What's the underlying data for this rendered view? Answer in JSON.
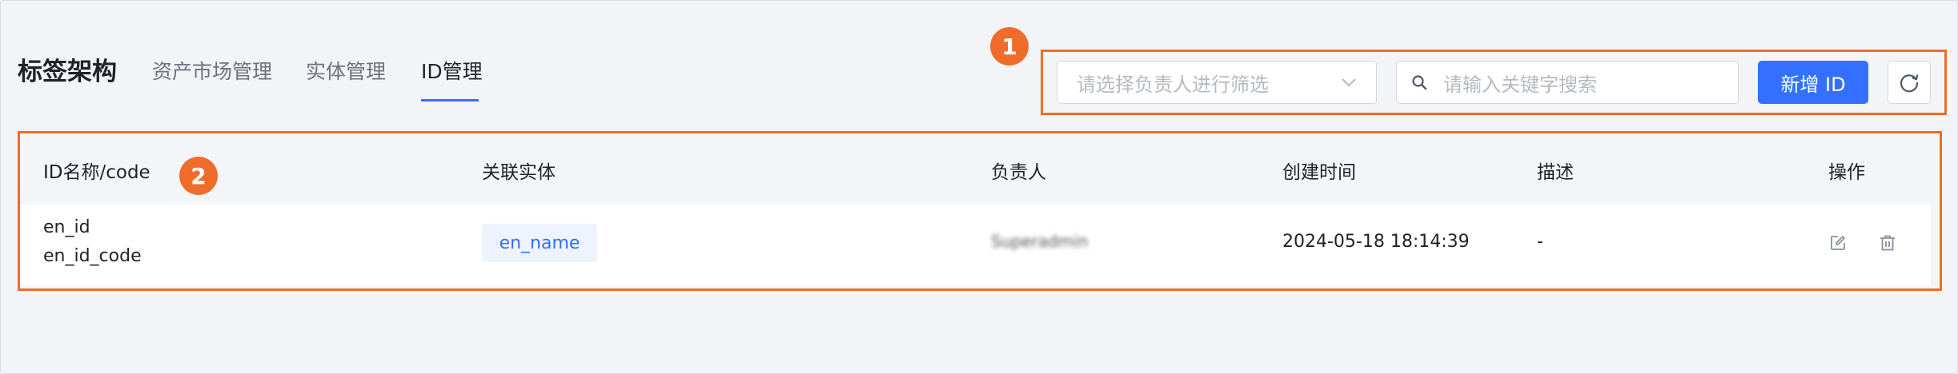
{
  "header": {
    "title": "标签架构",
    "tabs": [
      {
        "label": "资产市场管理",
        "active": false
      },
      {
        "label": "实体管理",
        "active": false
      },
      {
        "label": "ID管理",
        "active": true
      }
    ]
  },
  "toolbar": {
    "owner_select_placeholder": "请选择负责人进行筛选",
    "search_placeholder": "请输入关键字搜索",
    "add_button_label": "新增 ID",
    "refresh_icon": "refresh-icon"
  },
  "callouts": [
    "1",
    "2"
  ],
  "table": {
    "columns": [
      "ID名称/code",
      "关联实体",
      "负责人",
      "创建时间",
      "描述",
      "操作"
    ],
    "rows": [
      {
        "name": "en_id",
        "code": "en_id_code",
        "entity": "en_name",
        "owner": "Superadmin",
        "created_at": "2024-05-18 18:14:39",
        "description": "-",
        "actions": [
          "edit-icon",
          "delete-icon"
        ]
      }
    ]
  },
  "colors": {
    "accent": "#3370ff",
    "callout": "#ef6c2a",
    "background": "#f3f4f7"
  }
}
